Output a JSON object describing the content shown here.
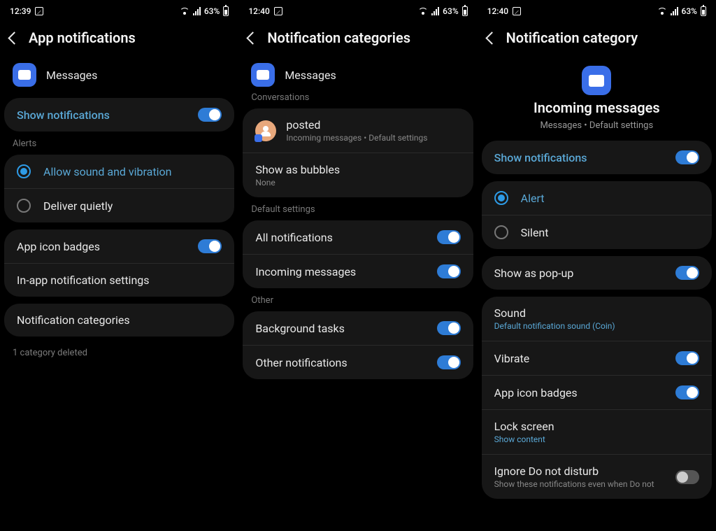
{
  "screens": [
    {
      "time": "12:39",
      "battery_pct": "63%",
      "title": "App notifications",
      "app": "Messages",
      "show_notifications": "Show notifications",
      "alerts_label": "Alerts",
      "allow_sound": "Allow sound and vibration",
      "deliver_quietly": "Deliver quietly",
      "app_icon_badges": "App icon badges",
      "in_app": "In-app notification settings",
      "categories": "Notification categories",
      "deleted_note": "1 category deleted"
    },
    {
      "time": "12:40",
      "battery_pct": "63%",
      "title": "Notification categories",
      "app": "Messages",
      "conversations_label": "Conversations",
      "posted": "posted",
      "posted_sub": "Incoming messages • Default settings",
      "show_bubbles": "Show as bubbles",
      "show_bubbles_sub": "None",
      "default_label": "Default settings",
      "all_notifications": "All notifications",
      "incoming": "Incoming messages",
      "other_label": "Other",
      "bg_tasks": "Background tasks",
      "other_notifs": "Other notifications"
    },
    {
      "time": "12:40",
      "battery_pct": "63%",
      "title": "Notification category",
      "center_title": "Incoming messages",
      "center_sub": "Messages • Default settings",
      "show_notifications": "Show notifications",
      "alert": "Alert",
      "silent": "Silent",
      "popup": "Show as pop-up",
      "sound": "Sound",
      "sound_sub": "Default notification sound (Coin)",
      "vibrate": "Vibrate",
      "app_icon_badges": "App icon badges",
      "lock_screen": "Lock screen",
      "lock_screen_sub": "Show content",
      "ignore_dnd": "Ignore Do not disturb",
      "ignore_dnd_sub": "Show these notifications even when Do not"
    }
  ]
}
